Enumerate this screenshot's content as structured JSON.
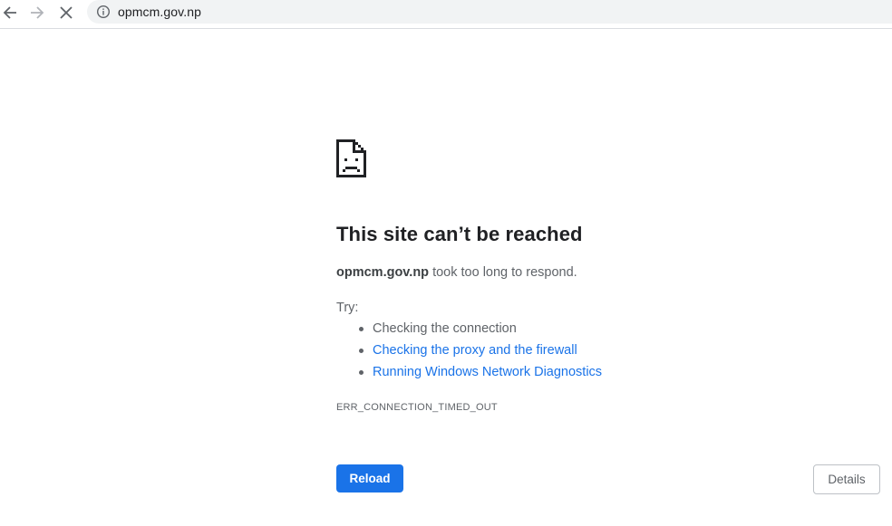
{
  "browser": {
    "url": "opmcm.gov.np",
    "icons": {
      "back": "arrow-left-icon",
      "forward": "arrow-right-icon",
      "stop": "close-icon",
      "site_info": "info-icon"
    }
  },
  "error_page": {
    "icon": "sad-page-icon",
    "headline": "This site can’t be reached",
    "summary_host": "opmcm.gov.np",
    "summary_text": " took too long to respond.",
    "try_label": "Try:",
    "suggestions": [
      {
        "text": "Checking the connection",
        "is_link": false
      },
      {
        "text": "Checking the proxy and the firewall",
        "is_link": true
      },
      {
        "text": "Running Windows Network Diagnostics",
        "is_link": true
      }
    ],
    "error_code": "ERR_CONNECTION_TIMED_OUT",
    "reload_label": "Reload",
    "details_label": "Details"
  },
  "colors": {
    "link": "#1a73e8",
    "primary_button": "#1a73e8",
    "headline": "#202124",
    "body_text": "#5f6368"
  }
}
